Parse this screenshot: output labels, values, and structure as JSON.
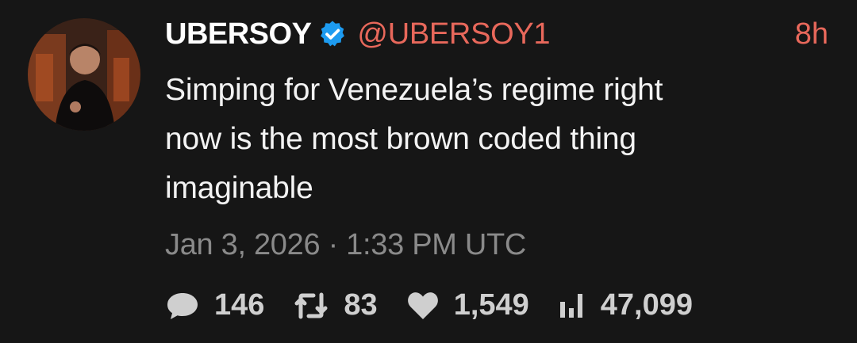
{
  "tweet": {
    "display_name": "UBERSOY",
    "handle": "@UBERSOY1",
    "time_ago": "8h",
    "text_lines": [
      "Simping for Venezuela’s regime right",
      "now is the most brown coded thing",
      "imaginable"
    ],
    "date": "Jan 3, 2026 · 1:33 PM UTC",
    "stats": {
      "replies": "146",
      "retweets": "83",
      "likes": "1,549",
      "views": "47,099"
    }
  },
  "colors": {
    "background": "#161616",
    "accent": "#e8685b",
    "verified": "#1d9bf0",
    "muted": "#8a8a8a"
  },
  "icons": [
    "verified-badge-icon",
    "reply-icon",
    "retweet-icon",
    "like-icon",
    "views-icon"
  ]
}
